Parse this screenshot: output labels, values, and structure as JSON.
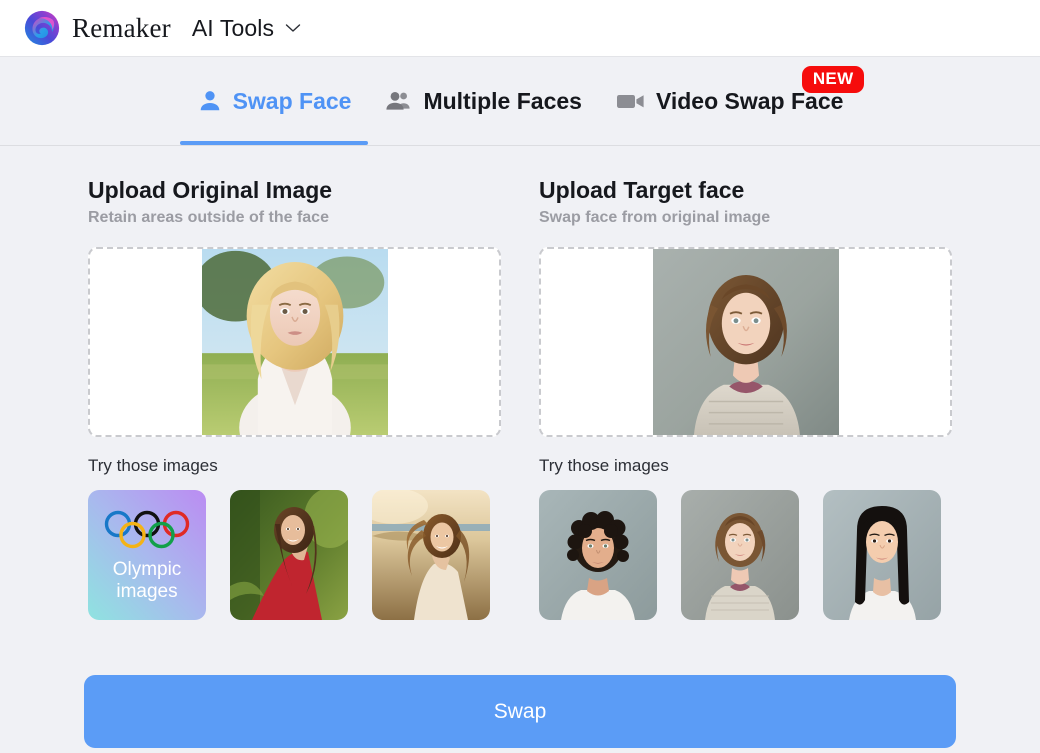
{
  "header": {
    "brand": "Remaker",
    "menu_label": "AI Tools",
    "logo_icon": "remaker-swirl-logo",
    "chevron_icon": "chevron-down-icon"
  },
  "tabs": [
    {
      "label": "Swap Face",
      "icon": "single-person-icon",
      "active": true,
      "badge": ""
    },
    {
      "label": "Multiple Faces",
      "icon": "multiple-people-icon",
      "active": false,
      "badge": ""
    },
    {
      "label": "Video Swap Face",
      "icon": "video-camera-icon",
      "active": false,
      "badge": "NEW"
    }
  ],
  "panels": [
    {
      "title": "Upload Original Image",
      "subtitle": "Retain areas outside of the face",
      "preview": "blonde-woman-outdoor-portrait",
      "try_label": "Try those images",
      "thumbs": [
        {
          "name": "olympic-images-tile",
          "label_line1": "Olympic",
          "label_line2": "images"
        },
        {
          "name": "woman-red-top-garden-thumb",
          "label_line1": "",
          "label_line2": ""
        },
        {
          "name": "woman-windswept-hair-beach-thumb",
          "label_line1": "",
          "label_line2": ""
        }
      ]
    },
    {
      "title": "Upload Target face",
      "subtitle": "Swap face from original image",
      "preview": "young-woman-grey-backdrop-portrait",
      "try_label": "Try those images",
      "thumbs": [
        {
          "name": "curly-haired-man-thumb",
          "label_line1": "",
          "label_line2": ""
        },
        {
          "name": "young-woman-sweater-thumb",
          "label_line1": "",
          "label_line2": ""
        },
        {
          "name": "asian-woman-thumb",
          "label_line1": "",
          "label_line2": ""
        }
      ]
    }
  ],
  "action": {
    "swap_label": "Swap"
  },
  "colors": {
    "accent_blue": "#5b9cf6",
    "tab_active_text": "#4f93f5",
    "badge_red": "#f60c0c",
    "page_bg": "#f0f1f5",
    "header_bg": "#ffffff",
    "muted_text": "#9b9ca3"
  }
}
